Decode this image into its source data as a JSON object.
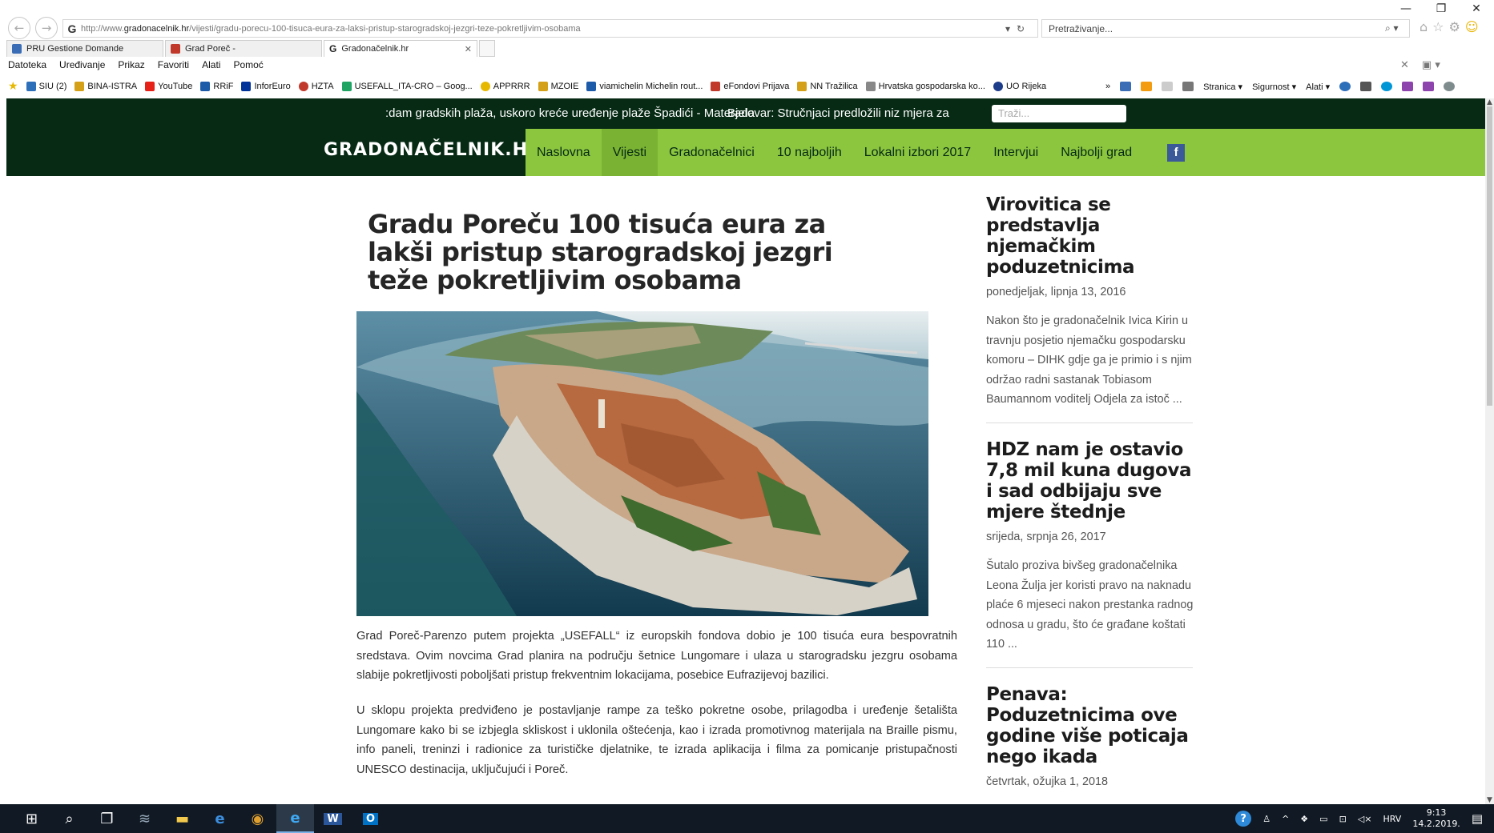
{
  "window": {
    "controls": [
      "—",
      "❐",
      "✕"
    ]
  },
  "browser": {
    "back_icon": "←",
    "forward_icon": "→",
    "address": {
      "prefix": "http://www.",
      "domain": "gradonacelnik.hr",
      "path": "/vijesti/gradu-porecu-100-tisuca-eura-za-laksi-pristup-starogradskoj-jezgri-teze-pokretljivim-osobama"
    },
    "search_placeholder": "Pretraživanje...",
    "tabs": [
      {
        "label": "PRU Gestione Domande",
        "color": "#3a6db5",
        "active": false
      },
      {
        "label": "Grad Poreč -",
        "color": "#c0392b",
        "active": false
      },
      {
        "label": "Gradonačelnik.hr",
        "color": "#333333",
        "active": true
      }
    ],
    "menu": [
      "Datoteka",
      "Uređivanje",
      "Prikaz",
      "Favoriti",
      "Alati",
      "Pomoć"
    ],
    "favorites": [
      {
        "label": "SIU (2)",
        "color": "#2e6fba"
      },
      {
        "label": "BINA-ISTRA",
        "color": "#d4a017"
      },
      {
        "label": "YouTube",
        "color": "#e62117"
      },
      {
        "label": "RRiF",
        "color": "#1d5aa8"
      },
      {
        "label": "InforEuro",
        "color": "#003399"
      },
      {
        "label": "HZTA",
        "color": "#c0392b"
      },
      {
        "label": "USEFALL_ITA-CRO – Goog...",
        "color": "#1fa463"
      },
      {
        "label": "APPRRR",
        "color": "#e6b800"
      },
      {
        "label": "MZOIE",
        "color": "#d4a017"
      },
      {
        "label": "viamichelin Michelin rout...",
        "color": "#1d5aa8"
      },
      {
        "label": "eFondovi Prijava",
        "color": "#c0392b"
      },
      {
        "label": "NN Tražilica",
        "color": "#d4a017"
      },
      {
        "label": "Hrvatska gospodarska ko...",
        "color": "#888888"
      },
      {
        "label": "UO Rijeka",
        "color": "#1d3c8a"
      }
    ],
    "command_bar": [
      "Stranica ▾",
      "Sigurnost ▾",
      "Alati ▾"
    ]
  },
  "site": {
    "ticker_text": ":dam gradskih plaža, uskoro kreće uređenje plaže Špadići - Materada",
    "ticker_text2": "Bjelovar: Stručnjaci predložili niz mjera za",
    "search_placeholder": "Traži...",
    "logo": "GRADONAČELNIK.HR",
    "nav": [
      {
        "label": "Naslovna",
        "active": false
      },
      {
        "label": "Vijesti",
        "active": true
      },
      {
        "label": "Gradonačelnici",
        "active": false
      },
      {
        "label": "10 najboljih",
        "active": false
      },
      {
        "label": "Lokalni izbori 2017",
        "active": false
      },
      {
        "label": "Intervjui",
        "active": false
      },
      {
        "label": "Najbolji grad",
        "active": false
      }
    ],
    "facebook_icon": "f",
    "article": {
      "title": "Gradu Poreču 100 tisuća eura za lakši pristup starogradskoj jezgri teže pokretljivim osobama",
      "p1": "Grad Poreč-Parenzo putem projekta „USEFALL“ iz europskih fondova dobio je 100 tisuća eura bespovratnih sredstava. Ovim novcima Grad planira na području šetnice Lungomare i ulaza u starogradsku jezgru osobama slabije pokretljivosti poboljšati pristup frekventnim lokacijama, posebice Eufrazijevoj bazilici.",
      "p2": "U sklopu projekta predviđeno je postavljanje rampe za teško pokretne osobe, prilagodba i uređenje šetališta Lungomare kako bi se izbjegla skliskost i uklonila oštećenja, kao i izrada promotivnog materijala na Braille pismu, info paneli, treninzi i radionice za turističke djelatnike, te izrada aplikacija i filma za pomicanje pristupačnosti UNESCO destinacija, uključujući i Poreč."
    },
    "sidebar": [
      {
        "title": "Virovitica se predstavlja njemačkim poduzetnicima",
        "date": "ponedjeljak, lipnja 13, 2016",
        "excerpt": "Nakon što je gradonačelnik Ivica Kirin u travnju posjetio njemačku gospodarsku komoru – DIHK gdje ga je primio i s njim održao radni sastanak Tobiasom Baumannom voditelj Odjela za istoč ..."
      },
      {
        "title": "HDZ nam je ostavio 7,8 mil kuna dugova i sad odbijaju sve mjere štednje",
        "date": "srijeda, srpnja 26, 2017",
        "excerpt": "  Šutalo proziva bivšeg gradonačelnika Leona Žulja jer koristi pravo na naknadu plaće 6 mjeseci nakon prestanka radnog odnosa u gradu, što će građane koštati 110 ..."
      },
      {
        "title": "Penava: Poduzetnicima ove godine više poticaja nego ikada",
        "date": "četvrtak, ožujka 1, 2018",
        "excerpt": ""
      }
    ]
  },
  "taskbar": {
    "language": "HRV",
    "time": "9:13",
    "date": "14.2.2019."
  }
}
